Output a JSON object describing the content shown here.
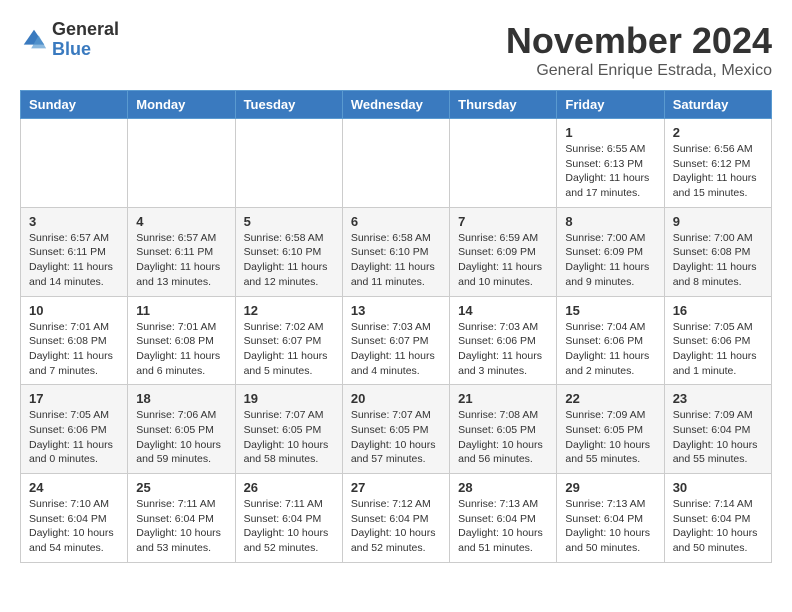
{
  "header": {
    "logo_general": "General",
    "logo_blue": "Blue",
    "month_title": "November 2024",
    "subtitle": "General Enrique Estrada, Mexico"
  },
  "days_of_week": [
    "Sunday",
    "Monday",
    "Tuesday",
    "Wednesday",
    "Thursday",
    "Friday",
    "Saturday"
  ],
  "weeks": [
    [
      {
        "day": "",
        "info": ""
      },
      {
        "day": "",
        "info": ""
      },
      {
        "day": "",
        "info": ""
      },
      {
        "day": "",
        "info": ""
      },
      {
        "day": "",
        "info": ""
      },
      {
        "day": "1",
        "info": "Sunrise: 6:55 AM\nSunset: 6:13 PM\nDaylight: 11 hours\nand 17 minutes."
      },
      {
        "day": "2",
        "info": "Sunrise: 6:56 AM\nSunset: 6:12 PM\nDaylight: 11 hours\nand 15 minutes."
      }
    ],
    [
      {
        "day": "3",
        "info": "Sunrise: 6:57 AM\nSunset: 6:11 PM\nDaylight: 11 hours\nand 14 minutes."
      },
      {
        "day": "4",
        "info": "Sunrise: 6:57 AM\nSunset: 6:11 PM\nDaylight: 11 hours\nand 13 minutes."
      },
      {
        "day": "5",
        "info": "Sunrise: 6:58 AM\nSunset: 6:10 PM\nDaylight: 11 hours\nand 12 minutes."
      },
      {
        "day": "6",
        "info": "Sunrise: 6:58 AM\nSunset: 6:10 PM\nDaylight: 11 hours\nand 11 minutes."
      },
      {
        "day": "7",
        "info": "Sunrise: 6:59 AM\nSunset: 6:09 PM\nDaylight: 11 hours\nand 10 minutes."
      },
      {
        "day": "8",
        "info": "Sunrise: 7:00 AM\nSunset: 6:09 PM\nDaylight: 11 hours\nand 9 minutes."
      },
      {
        "day": "9",
        "info": "Sunrise: 7:00 AM\nSunset: 6:08 PM\nDaylight: 11 hours\nand 8 minutes."
      }
    ],
    [
      {
        "day": "10",
        "info": "Sunrise: 7:01 AM\nSunset: 6:08 PM\nDaylight: 11 hours\nand 7 minutes."
      },
      {
        "day": "11",
        "info": "Sunrise: 7:01 AM\nSunset: 6:08 PM\nDaylight: 11 hours\nand 6 minutes."
      },
      {
        "day": "12",
        "info": "Sunrise: 7:02 AM\nSunset: 6:07 PM\nDaylight: 11 hours\nand 5 minutes."
      },
      {
        "day": "13",
        "info": "Sunrise: 7:03 AM\nSunset: 6:07 PM\nDaylight: 11 hours\nand 4 minutes."
      },
      {
        "day": "14",
        "info": "Sunrise: 7:03 AM\nSunset: 6:06 PM\nDaylight: 11 hours\nand 3 minutes."
      },
      {
        "day": "15",
        "info": "Sunrise: 7:04 AM\nSunset: 6:06 PM\nDaylight: 11 hours\nand 2 minutes."
      },
      {
        "day": "16",
        "info": "Sunrise: 7:05 AM\nSunset: 6:06 PM\nDaylight: 11 hours\nand 1 minute."
      }
    ],
    [
      {
        "day": "17",
        "info": "Sunrise: 7:05 AM\nSunset: 6:06 PM\nDaylight: 11 hours\nand 0 minutes."
      },
      {
        "day": "18",
        "info": "Sunrise: 7:06 AM\nSunset: 6:05 PM\nDaylight: 10 hours\nand 59 minutes."
      },
      {
        "day": "19",
        "info": "Sunrise: 7:07 AM\nSunset: 6:05 PM\nDaylight: 10 hours\nand 58 minutes."
      },
      {
        "day": "20",
        "info": "Sunrise: 7:07 AM\nSunset: 6:05 PM\nDaylight: 10 hours\nand 57 minutes."
      },
      {
        "day": "21",
        "info": "Sunrise: 7:08 AM\nSunset: 6:05 PM\nDaylight: 10 hours\nand 56 minutes."
      },
      {
        "day": "22",
        "info": "Sunrise: 7:09 AM\nSunset: 6:05 PM\nDaylight: 10 hours\nand 55 minutes."
      },
      {
        "day": "23",
        "info": "Sunrise: 7:09 AM\nSunset: 6:04 PM\nDaylight: 10 hours\nand 55 minutes."
      }
    ],
    [
      {
        "day": "24",
        "info": "Sunrise: 7:10 AM\nSunset: 6:04 PM\nDaylight: 10 hours\nand 54 minutes."
      },
      {
        "day": "25",
        "info": "Sunrise: 7:11 AM\nSunset: 6:04 PM\nDaylight: 10 hours\nand 53 minutes."
      },
      {
        "day": "26",
        "info": "Sunrise: 7:11 AM\nSunset: 6:04 PM\nDaylight: 10 hours\nand 52 minutes."
      },
      {
        "day": "27",
        "info": "Sunrise: 7:12 AM\nSunset: 6:04 PM\nDaylight: 10 hours\nand 52 minutes."
      },
      {
        "day": "28",
        "info": "Sunrise: 7:13 AM\nSunset: 6:04 PM\nDaylight: 10 hours\nand 51 minutes."
      },
      {
        "day": "29",
        "info": "Sunrise: 7:13 AM\nSunset: 6:04 PM\nDaylight: 10 hours\nand 50 minutes."
      },
      {
        "day": "30",
        "info": "Sunrise: 7:14 AM\nSunset: 6:04 PM\nDaylight: 10 hours\nand 50 minutes."
      }
    ]
  ]
}
